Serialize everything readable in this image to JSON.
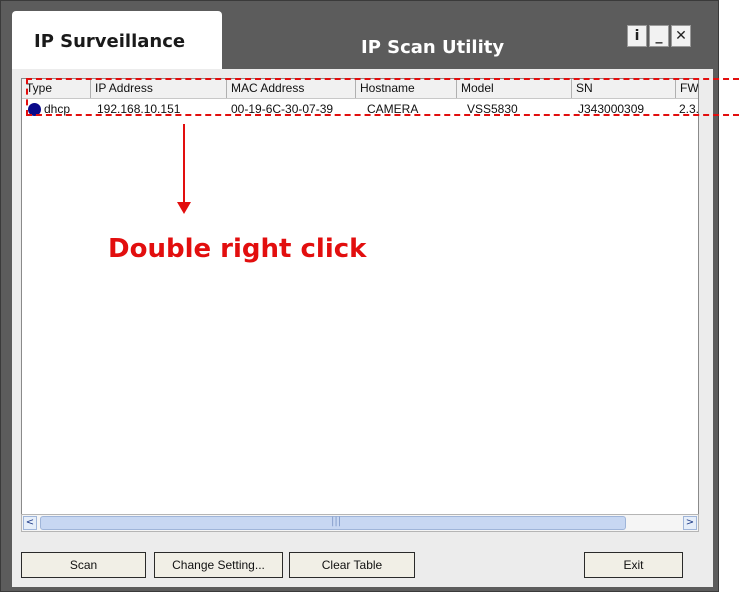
{
  "app": {
    "tab_label": "IP Surveillance",
    "title": "IP Scan Utility",
    "window_controls": [
      {
        "icon": "info-icon",
        "glyph": "i"
      },
      {
        "icon": "minimize-icon",
        "glyph": "_"
      },
      {
        "icon": "close-icon",
        "glyph": "✕"
      }
    ]
  },
  "table": {
    "columns": [
      "Type",
      "IP Address",
      "MAC Address",
      "Hostname",
      "Model",
      "SN",
      "FW"
    ],
    "rows": [
      {
        "status_color": "#0a0a8a",
        "type": "dhcp",
        "ip": "192.168.10.151",
        "mac": "00-19-6C-30-07-39",
        "hostname": "CAMERA",
        "model": "VSS5830",
        "sn": "J343000309",
        "fw": "2.3.."
      }
    ]
  },
  "buttons": {
    "scan": "Scan",
    "change_setting": "Change Setting...",
    "clear_table": "Clear Table",
    "exit": "Exit"
  },
  "annotation": {
    "text": "Double right click",
    "color": "#e20e0e"
  }
}
